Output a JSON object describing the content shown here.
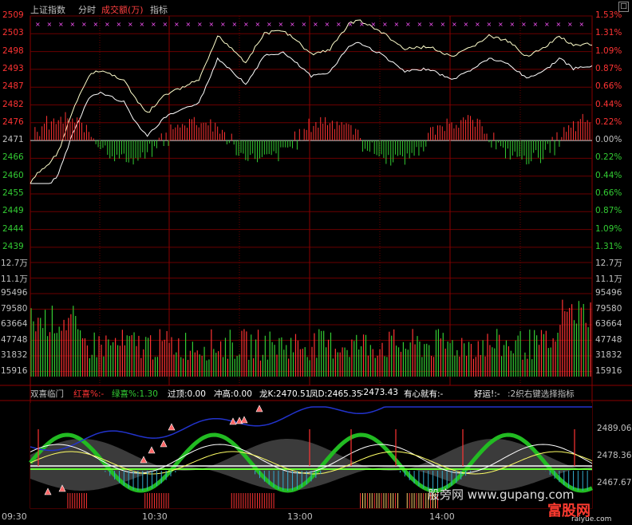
{
  "header": {
    "index_name": "上证指数",
    "tab_fenshi": "分时",
    "tab_volume": "成交额(万)",
    "tab_indicator": "指标",
    "window_button": "□"
  },
  "price_axis": {
    "left_labels": [
      "2509",
      "2503",
      "2498",
      "2493",
      "2487",
      "2482",
      "2476",
      "2471",
      "2466",
      "2460",
      "2455",
      "2449",
      "2444",
      "2439"
    ],
    "right_labels": [
      "1.53%",
      "1.31%",
      "1.09%",
      "0.87%",
      "0.66%",
      "0.44%",
      "0.22%",
      "0.00%",
      "0.22%",
      "0.44%",
      "0.66%",
      "0.87%",
      "1.09%",
      "1.31%"
    ],
    "base_index": 7
  },
  "volume_axis": {
    "labels": [
      "12.7万",
      "11.1万",
      "95496",
      "79580",
      "63664",
      "47748",
      "31832",
      "15916"
    ]
  },
  "indicator_bar": {
    "name": "双喜临门",
    "items": [
      "红喜%:-",
      "绿喜%:1.30",
      "过顶:0.00",
      "冲高:0.00",
      "龙K:2470.51",
      "凤D:2465.35",
      ":2473.43",
      "有心就有:-",
      "好运!:-",
      ":2织右键选择指标"
    ]
  },
  "indicator_axis": {
    "labels": [
      "2489.06",
      "2478.36",
      "2467.67"
    ]
  },
  "time_axis": [
    "09:30",
    "10:30",
    "13:00",
    "14:00"
  ],
  "watermark": {
    "text1": "股旁网 www.gupang.com",
    "text2": "富股网",
    "text3": "raiyue.com"
  },
  "colors": {
    "grid": "#7a0000",
    "price_up": "#ff3333",
    "price_down": "#33cc33",
    "price_line": "#ffffff",
    "avg_line": "#ffff99",
    "axis_red": "#ff3333",
    "axis_green": "#33cc33"
  }
}
